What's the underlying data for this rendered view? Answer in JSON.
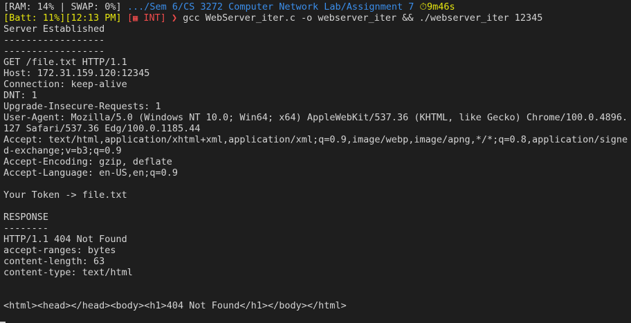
{
  "prompt": {
    "line1": {
      "ram": "[RAM: 14% | SWAP: 0%]",
      "path": ".../Sem 6/CS 3272 Computer Network Lab/Assignment 7",
      "timer_icon": "stopwatch-icon",
      "timer": "9m46s"
    },
    "line2": {
      "batt": "[Batt: 11%]",
      "time": "[12:13 PM]",
      "int_open": "[",
      "int_icon": "brick-icon",
      "int_label": " INT]",
      "arrow": "❯",
      "command": "gcc WebServer_iter.c -o webserver_iter && ./webserver_iter 12345"
    }
  },
  "output": {
    "established": "Server Established",
    "sep1": "------------------",
    "sep2": "------------------",
    "request": [
      "GET /file.txt HTTP/1.1",
      "Host: 172.31.159.120:12345",
      "Connection: keep-alive",
      "DNT: 1",
      "Upgrade-Insecure-Requests: 1",
      "User-Agent: Mozilla/5.0 (Windows NT 10.0; Win64; x64) AppleWebKit/537.36 (KHTML, like Gecko) Chrome/100.0.4896.",
      "127 Safari/537.36 Edg/100.0.1185.44",
      "Accept: text/html,application/xhtml+xml,application/xml;q=0.9,image/webp,image/apng,*/*;q=0.8,application/signe",
      "d-exchange;v=b3;q=0.9",
      "Accept-Encoding: gzip, deflate",
      "Accept-Language: en-US,en;q=0.9"
    ],
    "token": "Your Token -> file.txt",
    "response_title": "RESPONSE",
    "response_sep": "--------",
    "response": [
      "HTTP/1.1 404 Not Found",
      "accept-ranges: bytes",
      "content-length: 63",
      "content-type: text/html"
    ],
    "body": "<html><head></head><body><h1>404 Not Found</h1></body></html>"
  }
}
